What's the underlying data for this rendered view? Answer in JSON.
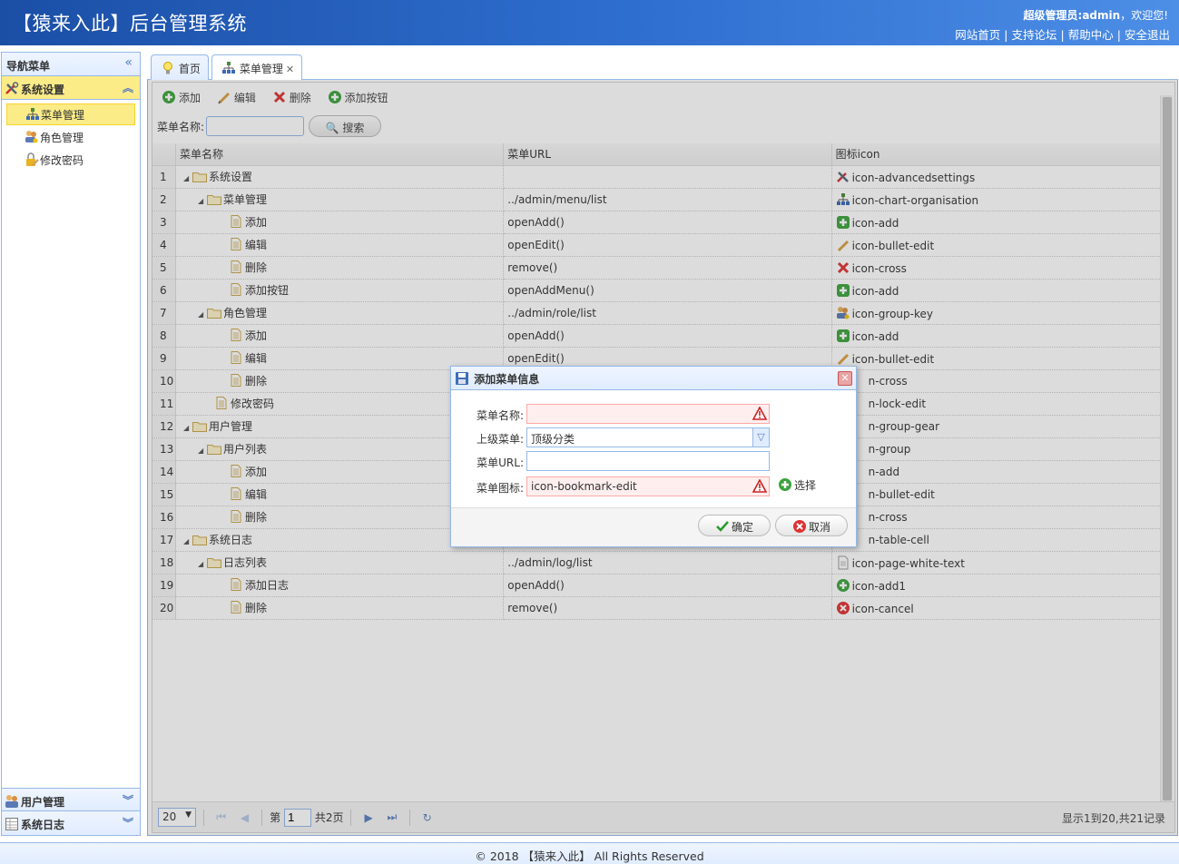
{
  "header": {
    "title": "【猿来入此】后台管理系统",
    "welcome_user": "超级管理员:admin",
    "welcome_suffix": "，欢迎您!",
    "links": [
      "网站首页",
      "支持论坛",
      "帮助中心",
      "安全退出"
    ]
  },
  "sidebar": {
    "title": "导航菜单",
    "groups": [
      {
        "label": "系统设置",
        "items": [
          "菜单管理",
          "角色管理",
          "修改密码"
        ]
      },
      {
        "label": "用户管理"
      },
      {
        "label": "系统日志"
      }
    ]
  },
  "tabs": [
    {
      "label": "首页"
    },
    {
      "label": "菜单管理"
    }
  ],
  "toolbar": {
    "add": "添加",
    "edit": "编辑",
    "delete": "删除",
    "add_button": "添加按钮"
  },
  "search": {
    "label": "菜单名称:",
    "value": "",
    "button": "搜索"
  },
  "table": {
    "columns": [
      "菜单名称",
      "菜单URL",
      "图标icon"
    ],
    "rows": [
      {
        "n": "1",
        "name": "系统设置",
        "url": "",
        "icon": "icon-advancedsettings"
      },
      {
        "n": "2",
        "name": "菜单管理",
        "url": "../admin/menu/list",
        "icon": "icon-chart-organisation"
      },
      {
        "n": "3",
        "name": "添加",
        "url": "openAdd()",
        "icon": "icon-add"
      },
      {
        "n": "4",
        "name": "编辑",
        "url": "openEdit()",
        "icon": "icon-bullet-edit"
      },
      {
        "n": "5",
        "name": "删除",
        "url": "remove()",
        "icon": "icon-cross"
      },
      {
        "n": "6",
        "name": "添加按钮",
        "url": "openAddMenu()",
        "icon": "icon-add"
      },
      {
        "n": "7",
        "name": "角色管理",
        "url": "../admin/role/list",
        "icon": "icon-group-key"
      },
      {
        "n": "8",
        "name": "添加",
        "url": "openAdd()",
        "icon": "icon-add"
      },
      {
        "n": "9",
        "name": "编辑",
        "url": "openEdit()",
        "icon": "icon-bullet-edit"
      },
      {
        "n": "10",
        "name": "删除",
        "url": "",
        "icon": "n-cross"
      },
      {
        "n": "11",
        "name": "修改密码",
        "url": "",
        "icon": "n-lock-edit"
      },
      {
        "n": "12",
        "name": "用户管理",
        "url": "",
        "icon": "n-group-gear"
      },
      {
        "n": "13",
        "name": "用户列表",
        "url": "",
        "icon": "n-group"
      },
      {
        "n": "14",
        "name": "添加",
        "url": "",
        "icon": "n-add"
      },
      {
        "n": "15",
        "name": "编辑",
        "url": "",
        "icon": "n-bullet-edit"
      },
      {
        "n": "16",
        "name": "删除",
        "url": "",
        "icon": "n-cross"
      },
      {
        "n": "17",
        "name": "系统日志",
        "url": "",
        "icon": "n-table-cell"
      },
      {
        "n": "18",
        "name": "日志列表",
        "url": "../admin/log/list",
        "icon": "icon-page-white-text"
      },
      {
        "n": "19",
        "name": "添加日志",
        "url": "openAdd()",
        "icon": "icon-add1"
      },
      {
        "n": "20",
        "name": "删除",
        "url": "remove()",
        "icon": "icon-cancel"
      }
    ]
  },
  "pager": {
    "page_size": "20",
    "page_prefix": "第",
    "page": "1",
    "page_total": "共2页",
    "info": "显示1到20,共21记录"
  },
  "dialog": {
    "title": "添加菜单信息",
    "fields": {
      "name_label": "菜单名称:",
      "name_value": "",
      "parent_label": "上级菜单:",
      "parent_value": "顶级分类",
      "url_label": "菜单URL:",
      "url_value": "",
      "icon_label": "菜单图标:",
      "icon_value": "icon-bookmark-edit",
      "pick": "选择"
    },
    "ok": "确定",
    "cancel": "取消"
  },
  "footer": {
    "text": "© 2018 【猿来入此】 All Rights Reserved"
  }
}
